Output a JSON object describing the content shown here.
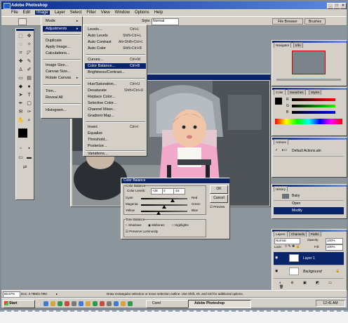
{
  "window": {
    "title": "Adobe Photoshop",
    "minimize": "_",
    "maximize": "□",
    "close": "×"
  },
  "menubar": [
    "File",
    "Edit",
    "Image",
    "Layer",
    "Select",
    "Filter",
    "View",
    "Window",
    "Options",
    "Help"
  ],
  "options_bar": {
    "style_label": "Style:",
    "style_value": "Normal",
    "file_browser_tab": "File Browser",
    "brushes_tab": "Brushes"
  },
  "image_menu": {
    "items": [
      "Mode",
      "Adjustments",
      "Duplicate",
      "Apply Image...",
      "Calculations...",
      "Image Size...",
      "Canvas Size...",
      "Rotate Canvas",
      "Trim...",
      "Reveal All",
      "Histogram..."
    ],
    "highlighted": "Adjustments"
  },
  "adjustments_submenu": {
    "items": [
      {
        "label": "Levels...",
        "shortcut": "Ctrl+L"
      },
      {
        "label": "Auto Levels",
        "shortcut": "Shift+Ctrl+L"
      },
      {
        "label": "Auto Contrast",
        "shortcut": "Alt+Shift+Ctrl+L"
      },
      {
        "label": "Auto Color",
        "shortcut": "Shift+Ctrl+B"
      },
      {
        "label": "Curves...",
        "shortcut": "Ctrl+M"
      },
      {
        "label": "Color Balance...",
        "shortcut": "Ctrl+B"
      },
      {
        "label": "Brightness/Contrast...",
        "shortcut": ""
      },
      {
        "label": "Hue/Saturation...",
        "shortcut": "Ctrl+U"
      },
      {
        "label": "Desaturate",
        "shortcut": "Shift+Ctrl+U"
      },
      {
        "label": "Replace Color...",
        "shortcut": ""
      },
      {
        "label": "Selective Color...",
        "shortcut": ""
      },
      {
        "label": "Channel Mixer...",
        "shortcut": ""
      },
      {
        "label": "Gradient Map...",
        "shortcut": ""
      },
      {
        "label": "Invert",
        "shortcut": "Ctrl+I"
      },
      {
        "label": "Equalize",
        "shortcut": ""
      },
      {
        "label": "Threshold...",
        "shortcut": ""
      },
      {
        "label": "Posterize...",
        "shortcut": ""
      },
      {
        "label": "Variations...",
        "shortcut": ""
      }
    ],
    "highlighted": "Color Balance..."
  },
  "color_balance_dialog": {
    "title": "Color Balance",
    "group_label": "Color Balance",
    "levels_label": "Color Levels:",
    "levels": [
      "+28",
      "0",
      "-16"
    ],
    "sliders": [
      {
        "left": "Cyan",
        "right": "Red",
        "position": 0.68
      },
      {
        "left": "Magenta",
        "right": "Green",
        "position": 0.5
      },
      {
        "left": "Yellow",
        "right": "Blue",
        "position": 0.38
      }
    ],
    "tone_label": "Tone Balance",
    "tones": [
      "Shadows",
      "Midtones",
      "Highlights"
    ],
    "preserve": "Preserve Luminosity",
    "ok": "OK",
    "cancel": "Cancel",
    "preview": "Preview"
  },
  "navigator_panel": {
    "tabs": [
      "Navigator",
      "Info"
    ]
  },
  "color_panel": {
    "tabs": [
      "Color",
      "Swatches",
      "Styles"
    ],
    "channels": [
      "R",
      "G",
      "B"
    ]
  },
  "actions_panel": {
    "tabs": [
      "Actions"
    ],
    "items": [
      "Default Actions.atn"
    ]
  },
  "history_panel": {
    "tabs": [
      "History"
    ],
    "items": [
      "Baby",
      "Open",
      "Modify"
    ]
  },
  "layers_panel": {
    "tabs": [
      "Layers",
      "Channels",
      "Paths"
    ],
    "blend_mode": "Normal",
    "opacity_label": "Opacity:",
    "opacity_value": "100%",
    "fill_label": "Fill:",
    "fill_value": "100%",
    "lock_label": "Lock:",
    "layers": [
      {
        "name": "Layer 1",
        "selected": true
      },
      {
        "name": "Background",
        "selected": false
      }
    ]
  },
  "status_bar": {
    "zoom": "66.67%",
    "doc": "Doc: 3.78M/3.78M",
    "hint": "Draw rectangular selection or move selection outline. Use Shift, Alt, and Ctrl for additional options."
  },
  "taskbar": {
    "start": "Start",
    "buttons": [
      "Corel",
      "Adobe Photoshop"
    ],
    "clock": "12:41 AM"
  },
  "colors": {
    "titlebar": "#0a246a",
    "face": "#d4d0c8",
    "workspace": "#8c959c"
  }
}
